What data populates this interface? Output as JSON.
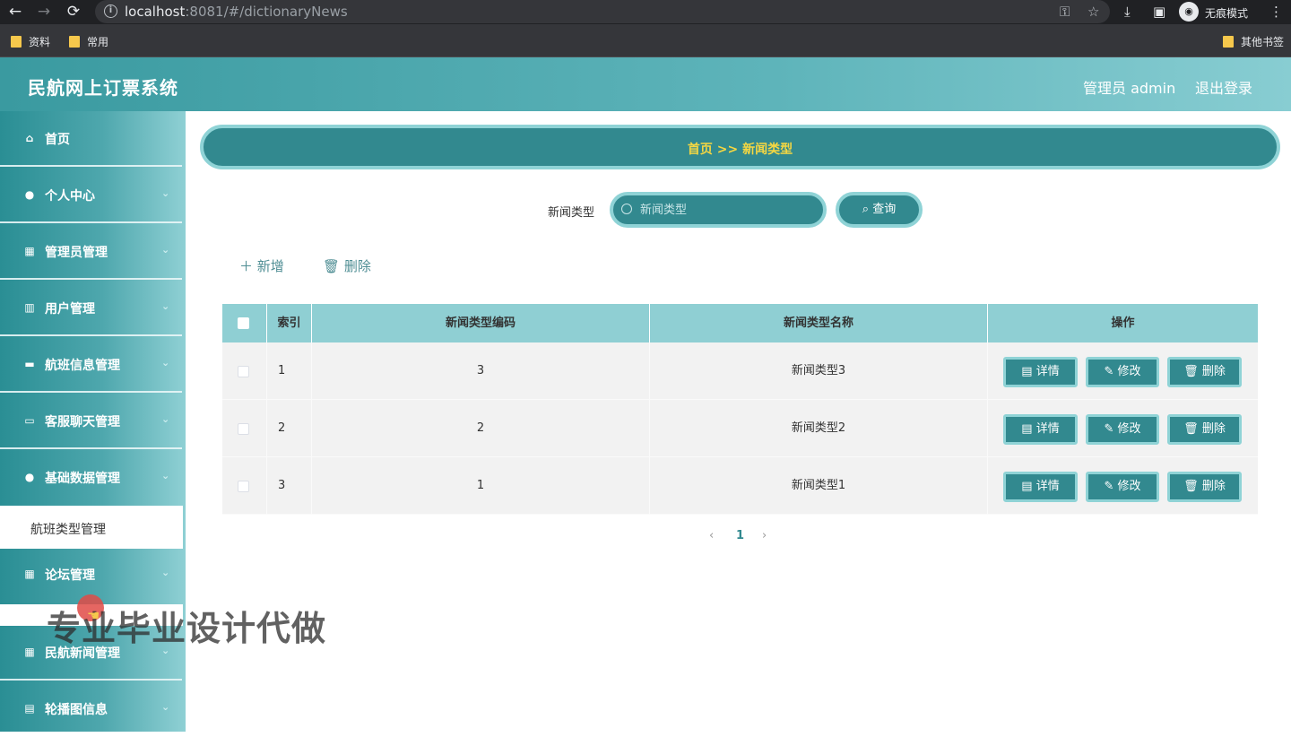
{
  "browser": {
    "url_host": "localhost",
    "url_rest": ":8081/#/dictionaryNews",
    "incognito_label": "无痕模式",
    "bookmarks": [
      "资料",
      "常用"
    ],
    "other_bookmarks": "其他书签"
  },
  "header": {
    "title": "民航网上订票系统",
    "user": "管理员 admin",
    "logout": "退出登录"
  },
  "sidebar": {
    "items": [
      {
        "label": "首页",
        "icon": "home-icon"
      },
      {
        "label": "个人中心",
        "icon": "user-icon"
      },
      {
        "label": "管理员管理",
        "icon": "grid-icon"
      },
      {
        "label": "用户管理",
        "icon": "book-icon"
      },
      {
        "label": "航班信息管理",
        "icon": "monitor-icon"
      },
      {
        "label": "客服聊天管理",
        "icon": "chat-icon"
      },
      {
        "label": "基础数据管理",
        "icon": "user-icon"
      },
      {
        "label": "论坛管理",
        "icon": "grid-icon"
      },
      {
        "label": "民航新闻管理",
        "icon": "grid-icon"
      },
      {
        "label": "轮播图信息",
        "icon": "clipboard-icon"
      }
    ],
    "submenu_active": "航班类型管理"
  },
  "breadcrumb": {
    "text": "首页 >> 新闻类型"
  },
  "search": {
    "label": "新闻类型",
    "placeholder": "新闻类型",
    "button": "查询"
  },
  "toolbar": {
    "add": "新增",
    "delete": "删除"
  },
  "table": {
    "headers": [
      "索引",
      "新闻类型编码",
      "新闻类型名称",
      "操作"
    ],
    "rows": [
      {
        "index": "1",
        "code": "3",
        "name": "新闻类型3"
      },
      {
        "index": "2",
        "code": "2",
        "name": "新闻类型2"
      },
      {
        "index": "3",
        "code": "1",
        "name": "新闻类型1"
      }
    ],
    "actions": {
      "detail": "详情",
      "edit": "修改",
      "delete": "删除"
    }
  },
  "pagination": {
    "current": "1"
  },
  "overlay": {
    "watermark": "专业毕业设计代做"
  },
  "colors": {
    "primary": "#32898f",
    "accent_border": "#8fd3d6",
    "breadcrumb_text": "#f5d742"
  }
}
